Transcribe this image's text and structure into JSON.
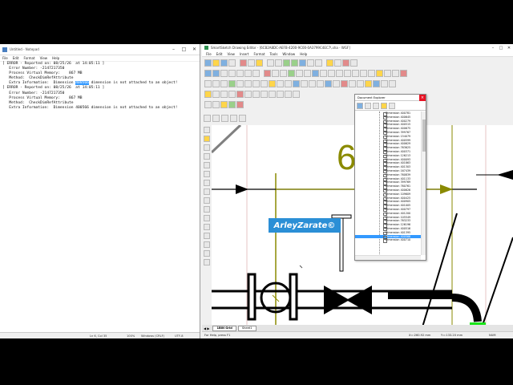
{
  "notepad": {
    "title": "Untitled - Notepad",
    "menu": [
      "File",
      "Edit",
      "Format",
      "View",
      "Help"
    ],
    "lines": {
      "l1": "[ ERROR - Reported on: 08/25/26  at 14:05:11 ]",
      "l2": "",
      "l3": "   Error Number: -2147217350",
      "l4": "   Process Virtual Memory:    867 MB",
      "l5": "   Method:  CheckDimRefAttribute",
      "l6a": "   Extra Information:  Dimension ",
      "l6hl": "400566",
      "l6b": " dimension is not attached to an object!",
      "l7": "",
      "l8": "[ ERROR - Reported on: 08/25/26  at 14:05:11 ]",
      "l9": "",
      "l10": "   Error Number: -2147217350",
      "l11": "   Process Virtual Memory:    867 MB",
      "l12": "   Method:  CheckDimRefAttribute",
      "l13": "   Extra Information:  Dimension 400566 dimension is not attached to an object!"
    },
    "status": {
      "position": "Ln 6, Col 35",
      "zoom": "100%",
      "eol": "Windows (CRLF)",
      "encoding": "UTF-8"
    }
  },
  "smartsketch": {
    "title": "SmartSketch Drawing Editor - [6CB2A8DC-AEFB-4200-9C00-0A3799C4EC7\\.sha - WGF]",
    "menu": [
      "File",
      "Edit",
      "View",
      "Insert",
      "Format",
      "Tools",
      "Window",
      "Help"
    ],
    "sheet_tabs": [
      "1BIN Grid",
      "Sheet1"
    ],
    "status": {
      "help": "For Help, press F1",
      "x": "X=:260.92 mm",
      "y": "Y=:133.20 mm",
      "num": "NUM"
    },
    "canvas_number": "6"
  },
  "document_explorer": {
    "title": "Document Explorer",
    "close": "×",
    "items": [
      "Dimension 400781",
      "Dimension 400645",
      "Dimension 400279",
      "Dimension 400515",
      "Dimension 400675",
      "Dimension 399767",
      "Dimension 154079",
      "Dimension 400599",
      "Dimension 400629",
      "Dimension 763625",
      "Dimension 400371",
      "Dimension 126213",
      "Dimension 400093",
      "Dimension 401863",
      "Dimension 401303",
      "Dimension 167439",
      "Dimension 760839",
      "Dimension 401133",
      "Dimension 399769",
      "Dimension 760761",
      "Dimension 400626",
      "Dimension 109609",
      "Dimension 400425",
      "Dimension 400905",
      "Dimension 401005",
      "Dimension 400797",
      "Dimension 401200",
      "Dimension 105549",
      "Dimension 763233",
      "Dimension 126196",
      "Dimension 400516",
      "Dimension 401395",
      "Dimension 400566",
      "Dimension 400710"
    ],
    "selected_index": 32
  },
  "watermark": "ArleyZarate©",
  "colors": {
    "pipe": "#000000",
    "dimension_olive": "#8a8a00",
    "highlight": "#3399ff",
    "watermark_bg": "#2b8fd6"
  }
}
